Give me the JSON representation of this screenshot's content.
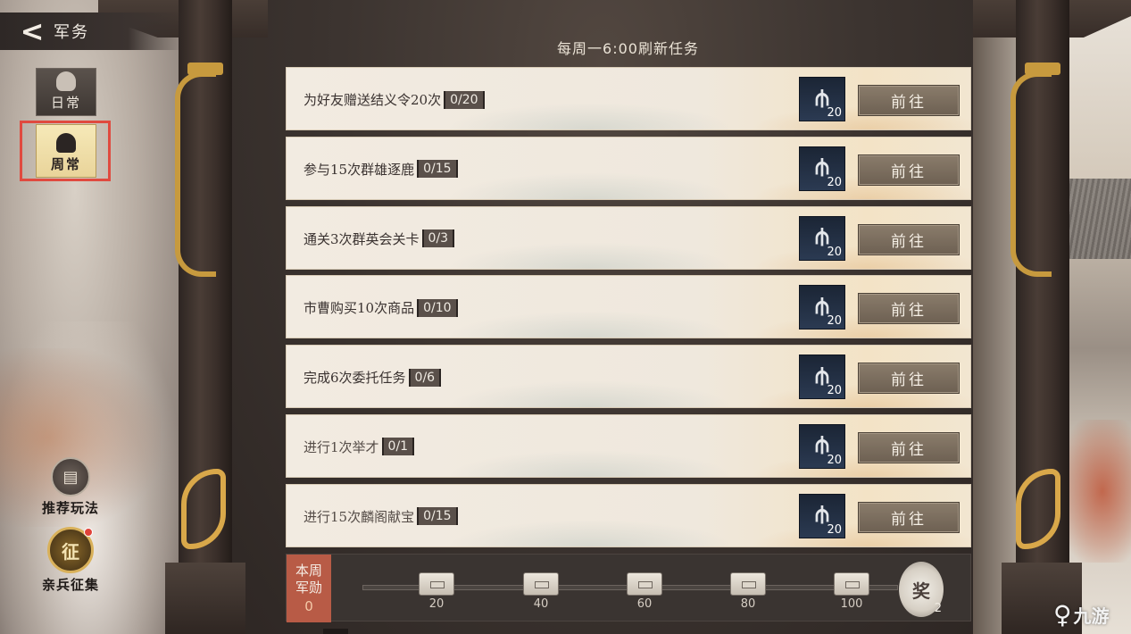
{
  "header": {
    "back_icon": "<",
    "title": "军务"
  },
  "refresh_note": "每周一6:00刷新任务",
  "tabs": [
    {
      "label": "日常",
      "icon": "daily-tab-icon",
      "selected": false
    },
    {
      "label": "周常",
      "icon": "weekly-tab-icon",
      "selected": true
    }
  ],
  "side_buttons": {
    "recommend": {
      "label": "推荐玩法",
      "icon": "scroll-icon"
    },
    "guard": {
      "label": "亲兵征集",
      "glyph": "征",
      "has_notification": true
    }
  },
  "tasks": [
    {
      "desc": "为好友赠送结义令20次",
      "progress": "0/20",
      "reward_count": "20",
      "button": "前往"
    },
    {
      "desc": "参与15次群雄逐鹿",
      "progress": "0/15",
      "reward_count": "20",
      "button": "前往"
    },
    {
      "desc": "通关3次群英会关卡",
      "progress": "0/3",
      "reward_count": "20",
      "button": "前往"
    },
    {
      "desc": "市曹购买10次商品",
      "progress": "0/10",
      "reward_count": "20",
      "button": "前往"
    },
    {
      "desc": "完成6次委托任务",
      "progress": "0/6",
      "reward_count": "20",
      "button": "前往"
    },
    {
      "desc": "进行1次举才",
      "progress": "0/1",
      "reward_count": "20",
      "button": "前往"
    },
    {
      "desc": "进行15次麟阁献宝",
      "progress": "0/15",
      "reward_count": "20",
      "button": "前往"
    }
  ],
  "progress_panel": {
    "label_line1": "本周",
    "label_line2": "军勋",
    "value": "0",
    "current": 0,
    "max": 100,
    "milestones": [
      "20",
      "40",
      "60",
      "80",
      "100"
    ],
    "final_reward_glyph": "奖",
    "final_reward_count": "2"
  },
  "watermark": {
    "logo": "♀",
    "text": "九游"
  },
  "colors": {
    "accent_gold": "#c79a3e",
    "highlight_red": "#e04a3f",
    "merit_box": "#b85b46",
    "go_button": "#7d6f5f"
  }
}
